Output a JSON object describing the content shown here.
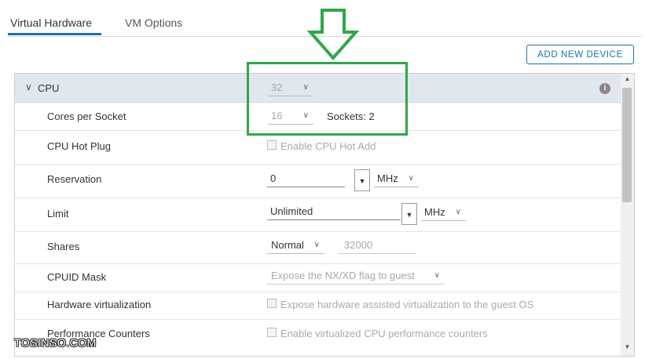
{
  "tabs": [
    {
      "label": "Virtual Hardware",
      "active": true
    },
    {
      "label": "VM Options",
      "active": false
    }
  ],
  "add_device_label": "ADD NEW DEVICE",
  "cpu": {
    "title": "CPU",
    "count": "32",
    "info_icon": "info-icon",
    "rows": {
      "cores": {
        "label": "Cores per Socket",
        "value": "16",
        "sockets_text": "Sockets: 2"
      },
      "hotplug": {
        "label": "CPU Hot Plug",
        "checkbox_label": "Enable CPU Hot Add"
      },
      "reservation": {
        "label": "Reservation",
        "value": "0",
        "unit": "MHz"
      },
      "limit": {
        "label": "Limit",
        "value": "Unlimited",
        "unit": "MHz"
      },
      "shares": {
        "label": "Shares",
        "level": "Normal",
        "value": "32000"
      },
      "cpuid": {
        "label": "CPUID Mask",
        "value": "Expose the NX/XD flag to guest"
      },
      "hwvirt": {
        "label": "Hardware virtualization",
        "checkbox_label": "Expose hardware assisted virtualization to the guest OS"
      },
      "perfcounters": {
        "label": "Performance Counters",
        "checkbox_label": "Enable virtualized CPU performance counters"
      }
    }
  },
  "watermark": "TOSINSO.COM",
  "colors": {
    "accent": "#1a73a8",
    "highlight": "#2ea84a",
    "header_bg": "#e1e7ee"
  }
}
